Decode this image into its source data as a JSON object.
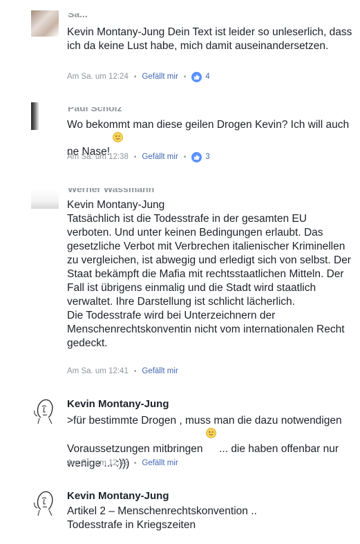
{
  "comments": [
    {
      "name_partial": "Sa...",
      "author": "",
      "text": "Kevin Montany-Jung Dein Text ist leider so unleserlich, dass ich da keine Lust habe, mich damit auseinandersetzen.",
      "time": "Am Sa. um 12:24",
      "like_label": "Gefällt mir",
      "reactions": "4"
    },
    {
      "name_partial": "Paul Scholz",
      "author": "",
      "text": "Wo bekommt man diese geilen Drogen Kevin? Ich will auch ne Nase!",
      "time": "Am Sa. um 12:38",
      "like_label": "Gefällt mir",
      "reactions": "3"
    },
    {
      "name_partial": "Werner Wassmann",
      "author": "",
      "text": "Kevin Montany-Jung\nTatsächlich ist die Todesstrafe in der gesamten EU verboten. Und unter keinen Bedingungen erlaubt. Das gesetzliche Verbot mit Verbrechen italienischer Kriminellen zu vergleichen, ist abwegig und erledigt sich von selbst. Der Staat bekämpft die Mafia mit rechtsstaatlichen Mitteln. Der Fall ist übrigens einmalig und die Stadt wird staatlich verwaltet. Ihre Darstellung ist schlicht lächerlich.\nDie Todesstrafe wird bei Unterzeichnern der Menschenrechtskonventin nicht vom internationalen Recht gedeckt.",
      "time": "Am Sa. um 12:41",
      "like_label": "Gefällt mir",
      "reactions": ""
    },
    {
      "name_partial": "",
      "author": "Kevin Montany-Jung",
      "text_a": ">für bestimmte Drogen , muss man die dazu notwendigen Voraussetzungen mitbringen",
      "text_b": " ... die haben offenbar nur wenige ... :)))",
      "time": "Am Sa. um 12:42",
      "like_label": "Gefällt mir",
      "reactions": ""
    },
    {
      "name_partial": "",
      "author": "Kevin Montany-Jung",
      "text": "Artikel 2 – Menschenrechtskonvention ..\n Todesstrafe in Kriegszeiten",
      "time": "",
      "like_label": "",
      "reactions": ""
    }
  ],
  "separator": "•",
  "icons": {
    "reaction": "thumbs-up-icon",
    "emoji_wink": "wink-emoji-icon",
    "avatar_sketch": "sketch-face-avatar"
  },
  "colors": {
    "text": "#1d2129",
    "meta": "#90949c",
    "link": "#4267b2",
    "like_badge": "#5890ff"
  }
}
